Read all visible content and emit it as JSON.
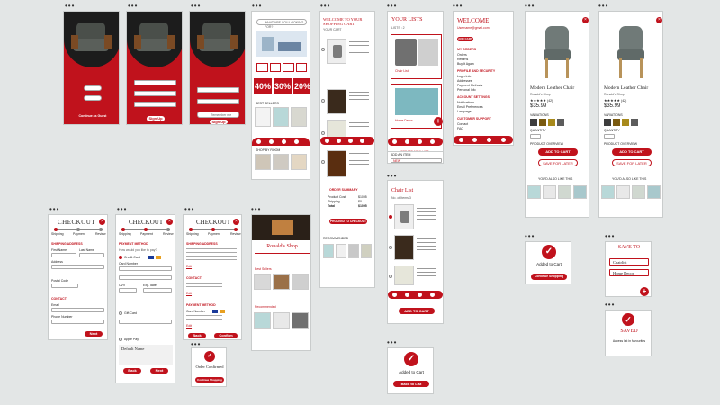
{
  "login": {
    "cont_label": "Continue as Guest",
    "signup_label": "Sign Up",
    "remember_label": "Remember me",
    "fields_s1": [
      "Email",
      "Login"
    ],
    "fields_s2": [
      "Name",
      "Email",
      "Password"
    ],
    "fields_s3": [
      "Name",
      "Password"
    ]
  },
  "home": {
    "search_placeholder": "WHAT ARE YOU LOOKING FOR?",
    "discounts": [
      "40%",
      "30%",
      "20%"
    ],
    "sections": [
      "BEST SELLERS",
      "SHOP BY ROOM"
    ]
  },
  "welcome_list": {
    "title": "WELCOME TO YOUR SHOPPING CART",
    "subtitle": "YOUR CART",
    "summary_title": "ORDER SUMMARY",
    "summary_rows": [
      [
        "Product Cost",
        "$1095"
      ],
      [
        "Shipping",
        "$0"
      ],
      [
        "Total",
        "$1095"
      ]
    ],
    "checkout_label": "PROCEED TO CHECKOUT",
    "recommended": "RECOMMENDED"
  },
  "your_lists": {
    "title": "YOUR LISTS",
    "count": "LISTS : 2",
    "list1": "Chair List",
    "list2": "Home Decor",
    "create_label": "CREATE NEW LIST",
    "add_item_label": "ADD AN ITEM",
    "new_label": "NEW"
  },
  "welcome_user": {
    "title": "WELCOME",
    "user": "Username@gmail.com",
    "add_label": "ADD CART",
    "menu_head1": "MY ORDERS",
    "menu1": [
      "Orders",
      "Returns",
      "Buy It Again"
    ],
    "menu_head2": "PROFILE AND SECURITY",
    "menu2": [
      "Login Info",
      "Addresses",
      "Payment Methods",
      "Personal Info"
    ],
    "menu_head3": "ACCOUNT SETTINGS",
    "menu3": [
      "Notifications",
      "Email Preferences",
      "Language"
    ],
    "menu_head4": "CUSTOMER SUPPORT",
    "menu4": [
      "Contact",
      "FAQ"
    ]
  },
  "product": {
    "name": "Modern Leather Chair",
    "brand": "Ronald's Shop",
    "price": "$35.99",
    "rating_count": "(42)",
    "variation_label": "VARIATIONS",
    "qty_label": "QUANTITY",
    "desc_label": "PRODUCT OVERVIEW",
    "add_cart": "ADD TO CART",
    "save_list": "SAVE FOR LATER",
    "more_label": "YOU'D ALSO LIKE THIS",
    "swatches": [
      "#3d3d3d",
      "#7a5a10",
      "#a88a1c",
      "#5c5c5c"
    ]
  },
  "checkout": {
    "title": "CHECKOUT",
    "steps": [
      "Shipping",
      "Payment",
      "Review"
    ],
    "ship_head": "SHIPPING ADDRESS",
    "ship_fields": [
      "First Name",
      "Last Name",
      "Address",
      "Postal Code"
    ],
    "contact_head": "CONTACT",
    "contact_fields": [
      "Email",
      "Phone Number"
    ],
    "next_label": "Next",
    "back_label": "Back",
    "pay_head": "PAYMENT METHOD",
    "pay_note": "How would you like to pay?",
    "pay_opts": [
      "Credit Card",
      "Gift Card",
      "Apple Pay"
    ],
    "pay_fields": [
      "Card Number",
      "CVV",
      "Exp. date"
    ],
    "default_name": "Default Name",
    "review_ship_head": "SHIPPING ADDRESS",
    "review_contact_head": "CONTACT",
    "review_pay_head": "PAYMENT METHOD",
    "review_edit": "Edit",
    "confirm_label": "Confirm",
    "review_card": "Card Number"
  },
  "shop": {
    "title": "Ronald's Shop",
    "best": "Best Sellers",
    "recommended": "Recommended"
  },
  "chair_list": {
    "title": "Chair List",
    "count": "No. of Items 3",
    "add_label": "ADD TO CART"
  },
  "confirm": {
    "order_confirmed": "Order Confirmed",
    "continue_shopping": "Continue Shopping",
    "added_cart": "Added to Cart",
    "back_list": "Back to List",
    "save_to": "SAVE TO",
    "save_opts": [
      "Chairlist",
      "Home Decor"
    ],
    "saved": "SAVED",
    "saved_sub": "Access list in favourites"
  }
}
